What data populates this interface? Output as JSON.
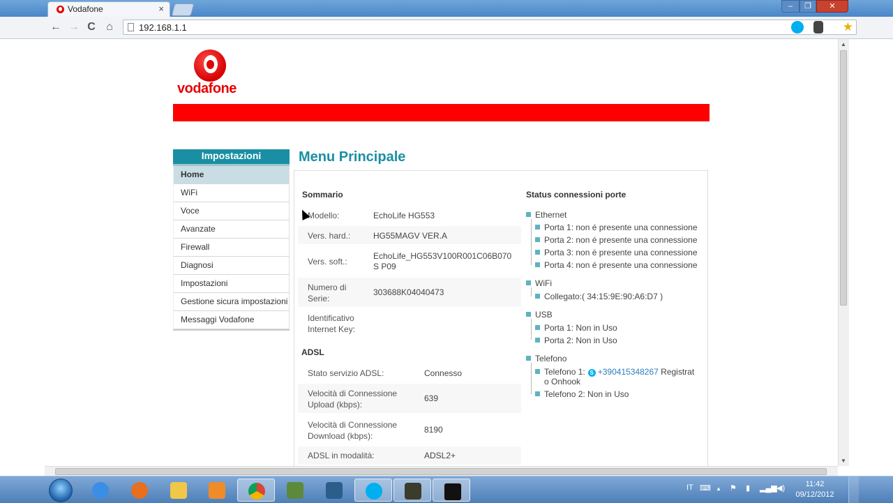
{
  "browser": {
    "tab_title": "Vodafone",
    "tab_close": "×",
    "url": "192.168.1.1",
    "nav": {
      "back": "←",
      "forward": "→",
      "reload": "C",
      "home": "⌂",
      "star": "★",
      "menu": "≡"
    }
  },
  "brand": {
    "logo_text": "vodafone",
    "bar_color": "#ff0000",
    "accent": "#1a8fa3"
  },
  "sidebar": {
    "title": "Impostazioni",
    "items": [
      {
        "label": "Home",
        "active": true
      },
      {
        "label": "WiFi"
      },
      {
        "label": "Voce"
      },
      {
        "label": "Avanzate"
      },
      {
        "label": "Firewall"
      },
      {
        "label": "Diagnosi"
      },
      {
        "label": "Impostazioni"
      },
      {
        "label": "Gestione sicura impostazioni"
      },
      {
        "label": "Messaggi Vodafone"
      }
    ]
  },
  "main": {
    "title": "Menu Principale",
    "sommario": {
      "title": "Sommario",
      "rows": [
        {
          "label": "Modello:",
          "value": "EchoLife  HG553"
        },
        {
          "label": "Vers. hard.:",
          "value": "HG55MAGV VER.A"
        },
        {
          "label": "Vers. soft.:",
          "value": "EchoLife_HG553V100R001C06B070S P09"
        },
        {
          "label": "Numero di Serie:",
          "value": "303688K04040473"
        },
        {
          "label": "Identificativo Internet Key:",
          "value": ""
        }
      ]
    },
    "adsl": {
      "title": "ADSL",
      "rows": [
        {
          "label": "Stato servizio ADSL:",
          "value": "Connesso"
        },
        {
          "label": "Velocità di Connessione Upload (kbps):",
          "value": "639"
        },
        {
          "label": "Velocità di Connessione Download (kbps):",
          "value": "8190"
        },
        {
          "label": "ADSL in modalità:",
          "value": "ADSL2+"
        }
      ]
    },
    "status": {
      "title": "Status connessioni porte",
      "ethernet": {
        "label": "Ethernet",
        "ports": [
          "Porta 1: non é presente una connessione",
          "Porta 2: non é presente una connessione",
          "Porta 3: non é presente una connessione",
          "Porta 4: non é presente una connessione"
        ]
      },
      "wifi": {
        "label": "WiFi",
        "items": [
          "Collegato:( 34:15:9E:90:A6:D7 )"
        ]
      },
      "usb": {
        "label": "USB",
        "items": [
          "Porta 1: Non in Uso",
          "Porta 2: Non in Uso"
        ]
      },
      "telefono": {
        "label": "Telefono",
        "tel1_prefix": "Telefono 1:",
        "tel1_number": "+390415348267",
        "tel1_suffix_a": "Registrat",
        "tel1_suffix_b": "o Onhook",
        "tel2": "Telefono 2: Non in Uso"
      }
    }
  },
  "taskbar": {
    "lang": "IT",
    "time": "11:42",
    "date": "09/12/2012"
  }
}
